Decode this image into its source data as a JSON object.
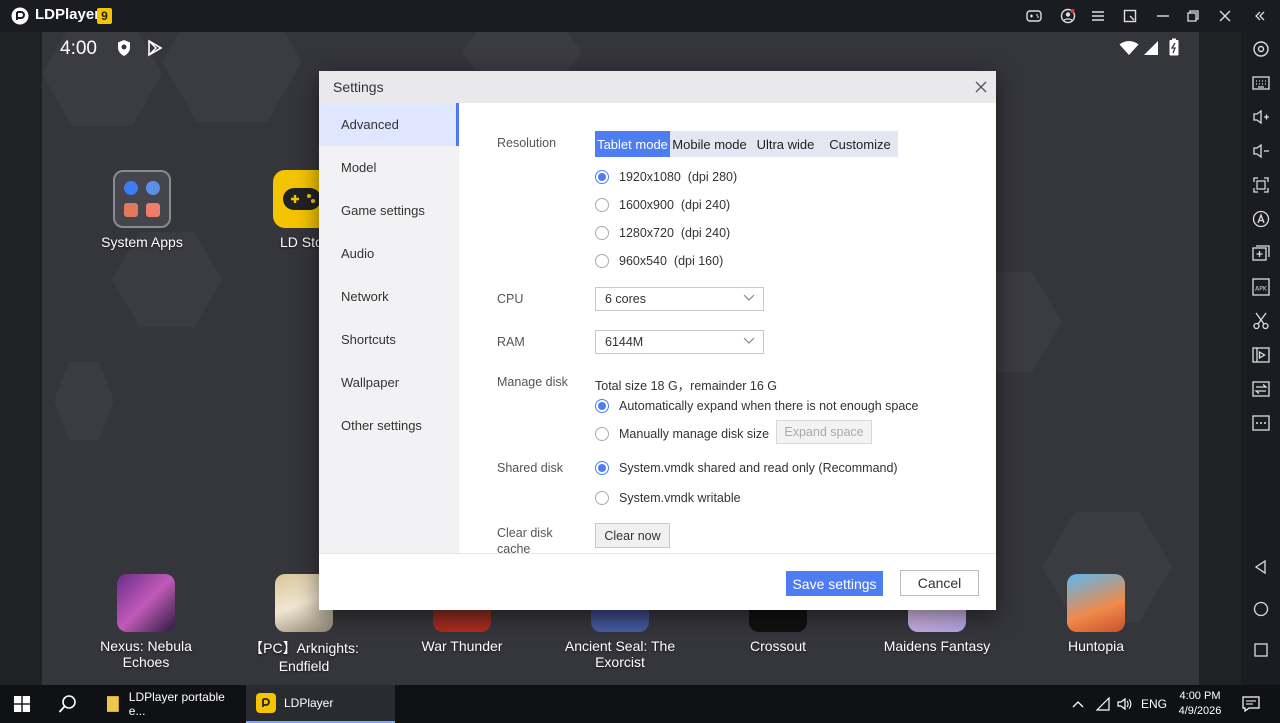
{
  "window": {
    "app_name": "LDPlayer",
    "version_badge": "9"
  },
  "status_bar": {
    "time": "4:00"
  },
  "home_apps": {
    "system_apps": "System Apps",
    "ld_store": "LD Stor"
  },
  "dock_apps": [
    {
      "label": "Nexus: Nebula Echoes"
    },
    {
      "label": "【PC】Arknights: Endfield"
    },
    {
      "label": "War Thunder"
    },
    {
      "label": "Ancient Seal: The Exorcist"
    },
    {
      "label": "Crossout"
    },
    {
      "label": "Maidens Fantasy"
    },
    {
      "label": "Huntopia"
    }
  ],
  "settings": {
    "title": "Settings",
    "nav": [
      {
        "label": "Advanced"
      },
      {
        "label": "Model"
      },
      {
        "label": "Game settings"
      },
      {
        "label": "Audio"
      },
      {
        "label": "Network"
      },
      {
        "label": "Shortcuts"
      },
      {
        "label": "Wallpaper"
      },
      {
        "label": "Other settings"
      }
    ],
    "resolution": {
      "label": "Resolution",
      "modes": [
        "Tablet mode",
        "Mobile mode",
        "Ultra wide",
        "Customize"
      ],
      "selected_mode": "Tablet mode",
      "options": [
        "1920x1080  (dpi 280)",
        "1600x900  (dpi 240)",
        "1280x720  (dpi 240)",
        "960x540  (dpi 160)"
      ],
      "selected_option": "1920x1080  (dpi 280)"
    },
    "cpu": {
      "label": "CPU",
      "value": "6 cores"
    },
    "ram": {
      "label": "RAM",
      "value": "6144M"
    },
    "manage_disk": {
      "label": "Manage disk",
      "info": "Total size 18 G，remainder 16 G",
      "auto_option": "Automatically expand when there is not enough space",
      "manual_option": "Manually manage disk size",
      "expand_button": "Expand space"
    },
    "shared_disk": {
      "label": "Shared disk",
      "option_readonly": "System.vmdk shared and read only (Recommand)",
      "option_writable": "System.vmdk writable"
    },
    "clear_cache": {
      "label_line1": "Clear disk",
      "label_line2": "cache",
      "button": "Clear now"
    },
    "save_button": "Save settings",
    "cancel_button": "Cancel"
  },
  "taskbar": {
    "item1": "LDPlayer portable e...",
    "item2": "LDPlayer",
    "lang": "ENG",
    "time": "4:00 PM",
    "date": "4/9/2026"
  },
  "colors": {
    "accent": "#4e7cf2",
    "badge": "#f5c400"
  }
}
